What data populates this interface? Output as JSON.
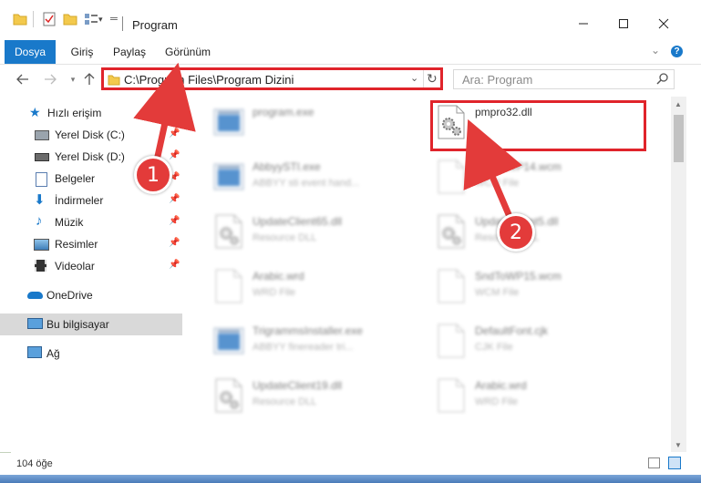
{
  "window": {
    "title": "Program"
  },
  "ribbon": {
    "tabs": [
      "Dosya",
      "Giriş",
      "Paylaş",
      "Görünüm"
    ]
  },
  "address": {
    "path": "C:\\Program Files\\Program Dizini"
  },
  "search": {
    "placeholder": "Ara: Program"
  },
  "sidebar": {
    "quick_access": "Hızlı erişim",
    "items": [
      {
        "label": "Yerel Disk (C:)",
        "pinned": true
      },
      {
        "label": "Yerel Disk (D:)",
        "pinned": true
      },
      {
        "label": "Belgeler",
        "pinned": true
      },
      {
        "label": "İndirmeler",
        "pinned": true
      },
      {
        "label": "Müzik",
        "pinned": true
      },
      {
        "label": "Resimler",
        "pinned": true
      },
      {
        "label": "Videolar",
        "pinned": true
      }
    ],
    "onedrive": "OneDrive",
    "this_pc": "Bu bilgisayar",
    "network": "Ağ"
  },
  "files": [
    {
      "name": "program.exe",
      "type": "",
      "icon": "exe-icon"
    },
    {
      "name": "pmpro32.dll",
      "type": "",
      "icon": "dll-gear-icon"
    },
    {
      "name": "AbbyySTI.exe",
      "type": "ABBYY sti event hand...",
      "icon": "exe-icon"
    },
    {
      "name": "SndToWP14.wcm",
      "type": "WCM File",
      "icon": "file-icon"
    },
    {
      "name": "UpdateClient65.dll",
      "type": "Resource DLL",
      "icon": "dll-gear-icon"
    },
    {
      "name": "UpdateClient5.dll",
      "type": "Resource DLL",
      "icon": "dll-gear-icon"
    },
    {
      "name": "Arabic.wrd",
      "type": "WRD File",
      "icon": "file-icon"
    },
    {
      "name": "SndToWP15.wcm",
      "type": "WCM File",
      "icon": "file-icon"
    },
    {
      "name": "TrigrammsInstaller.exe",
      "type": "ABBYY finereader tri...",
      "icon": "exe-icon"
    },
    {
      "name": "DefaultFont.cjk",
      "type": "CJK File",
      "icon": "file-icon"
    },
    {
      "name": "UpdateClient19.dll",
      "type": "Resource DLL",
      "icon": "dll-gear-icon"
    },
    {
      "name": "Arabic.wrd",
      "type": "WRD File",
      "icon": "file-icon"
    }
  ],
  "status": {
    "count": "104 öğe"
  },
  "annotations": {
    "step1": "1",
    "step2": "2"
  },
  "colors": {
    "accent": "#1979ca",
    "highlight": "#e0242b",
    "badge": "#e33b3a"
  }
}
